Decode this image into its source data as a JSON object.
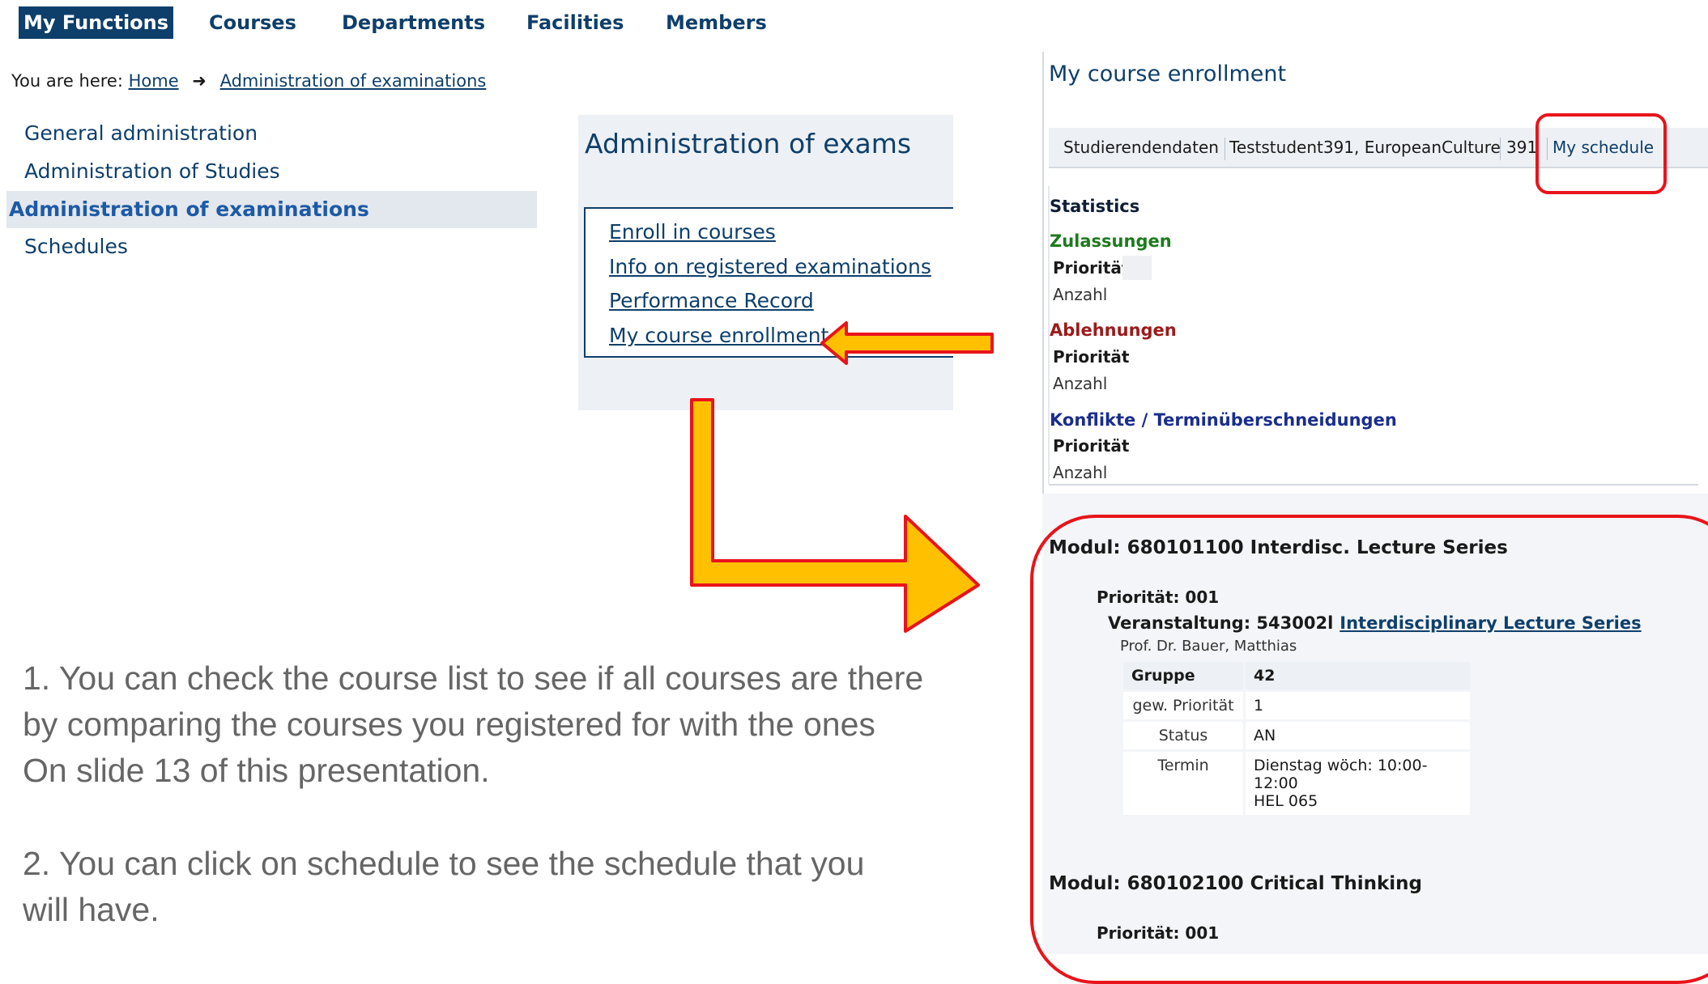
{
  "topnav": {
    "items": [
      "My Functions",
      "Courses",
      "Departments",
      "Facilities",
      "Members"
    ],
    "active_index": 0
  },
  "breadcrumb": {
    "prefix": "You are here:",
    "home": "Home",
    "current": "Administration of examinations"
  },
  "sidebar": {
    "items": [
      "General administration",
      "Administration of Studies",
      "Administration of examinations",
      "Schedules"
    ],
    "active_index": 2
  },
  "exams": {
    "title": "Administration of exams",
    "links": [
      "Enroll in courses",
      "Info on registered examinations",
      "Performance Record",
      "My course enrollment"
    ]
  },
  "instructions": {
    "line1": "1. You can check the course list to see if all courses are there",
    "line2": " by comparing the courses you registered for with the ones",
    "line3": "On slide 13 of this presentation.",
    "line4": "2. You can click on schedule to see the schedule that you",
    "line5": "will have."
  },
  "enrollment": {
    "title": "My course enrollment",
    "tabs": {
      "data": "Studierendendaten",
      "student": "Teststudent391, EuropeanCulture",
      "id": "391",
      "schedule": "My schedule"
    },
    "statistics": {
      "title": "Statistics",
      "zulassungen": "Zulassungen",
      "ablehnungen": "Ablehnungen",
      "konflikte": "Konflikte / Terminüberschneidungen",
      "prioritaet": "Priorität",
      "anzahl": "Anzahl"
    },
    "modules": [
      {
        "title": "Modul: 680101100 Interdisc. Lecture Series",
        "priority": "Priorität: 001",
        "event_label": "Veranstaltung: 543002l",
        "event_link": "Interdisciplinary Lecture Series",
        "lecturer": "Prof. Dr. Bauer, Matthias",
        "table": {
          "gruppe_label": "Gruppe",
          "gruppe_value": "42",
          "gew_label": "gew. Priorität",
          "gew_value": "1",
          "status_label": "Status",
          "status_value": "AN",
          "termin_label": "Termin",
          "termin_line1": "Dienstag wöch: 10:00-12:00",
          "termin_line2": "HEL 065"
        }
      },
      {
        "title": "Modul: 680102100 Critical Thinking",
        "priority": "Priorität: 001"
      }
    ]
  },
  "colors": {
    "brand_navy": "#0e3f6b",
    "link_blue": "#1d5aa6",
    "annotation_red": "#e8141b",
    "arrow_yellow": "#ffc000",
    "status_green": "#1e7a1e",
    "status_red": "#9b1b1b",
    "status_blue": "#1a2e8c"
  },
  "icons": {
    "breadcrumb_separator": "arrow-right-icon",
    "callout_left": "arrow-left-icon",
    "callout_elbow": "elbow-arrow-right-icon"
  }
}
